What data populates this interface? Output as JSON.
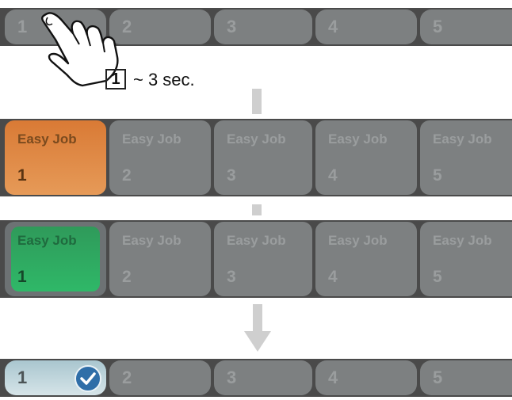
{
  "row1": {
    "labels": [
      "1",
      "2",
      "3",
      "4",
      "5"
    ]
  },
  "step": {
    "number": "1",
    "text": "~ 3 sec."
  },
  "row2": {
    "title": "Easy Job",
    "numbers": [
      "1",
      "2",
      "3",
      "4",
      "5"
    ]
  },
  "row3": {
    "title": "Easy Job",
    "numbers": [
      "1",
      "2",
      "3",
      "4",
      "5"
    ]
  },
  "row4": {
    "labels": [
      "1",
      "2",
      "3",
      "4",
      "5"
    ]
  },
  "colors": {
    "orange": "#e0873f",
    "green": "#2fb466",
    "check": "#2f6ea8"
  },
  "icons": [
    "hand-pointer-icon",
    "arrow-down-icon",
    "checkmark-icon"
  ]
}
